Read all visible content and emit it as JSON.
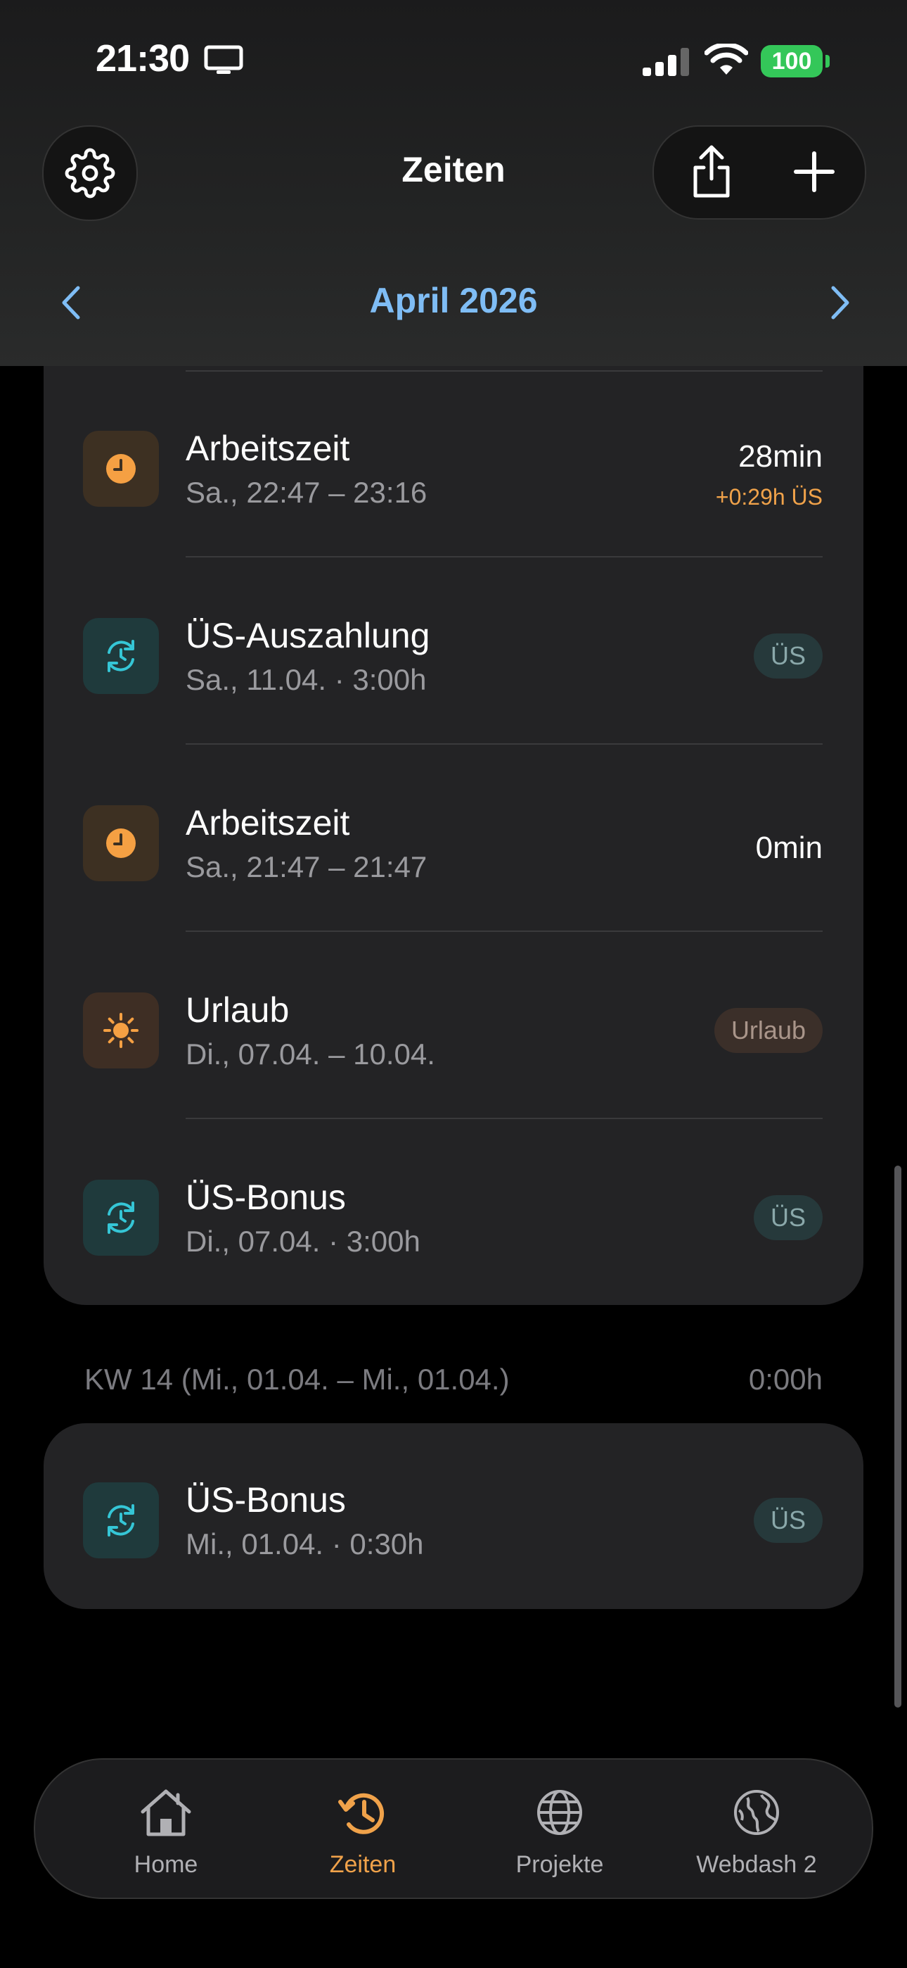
{
  "status_bar": {
    "time": "21:30",
    "battery": "100"
  },
  "header": {
    "title": "Zeiten"
  },
  "month_nav": {
    "label": "April 2026"
  },
  "entries": [
    {
      "title": "Arbeitszeit",
      "subtitle": "Sa., 22:47 – 23:16",
      "value": "28min",
      "extra": "+0:29h ÜS",
      "icon": "clock-icon"
    },
    {
      "title": "ÜS-Auszahlung",
      "subtitle": "Sa., 11.04. · 3:00h",
      "badge": "ÜS",
      "icon": "overtime-icon"
    },
    {
      "title": "Arbeitszeit",
      "subtitle": "Sa., 21:47 – 21:47",
      "value": "0min",
      "icon": "clock-icon"
    },
    {
      "title": "Urlaub",
      "subtitle": "Di., 07.04. – 10.04.",
      "badge": "Urlaub",
      "icon": "sun-icon"
    },
    {
      "title": "ÜS-Bonus",
      "subtitle": "Di., 07.04. · 3:00h",
      "badge": "ÜS",
      "icon": "overtime-icon"
    }
  ],
  "week14": {
    "label": "KW 14 (Mi., 01.04. – Mi., 01.04.)",
    "total": "0:00h",
    "entries": [
      {
        "title": "ÜS-Bonus",
        "subtitle": "Mi., 01.04. · 0:30h",
        "badge": "ÜS",
        "icon": "overtime-icon"
      }
    ]
  },
  "tabs": [
    {
      "label": "Home",
      "icon": "home-icon",
      "active": false
    },
    {
      "label": "Zeiten",
      "icon": "history-icon",
      "active": true
    },
    {
      "label": "Projekte",
      "icon": "globe-icon",
      "active": false
    },
    {
      "label": "Webdash 2",
      "icon": "earth-icon",
      "active": false
    }
  ],
  "colors": {
    "accent": "#f0a24a",
    "link": "#7fbdf5",
    "teal": "#35c6d6",
    "background": "#000000",
    "card": "#232325"
  }
}
